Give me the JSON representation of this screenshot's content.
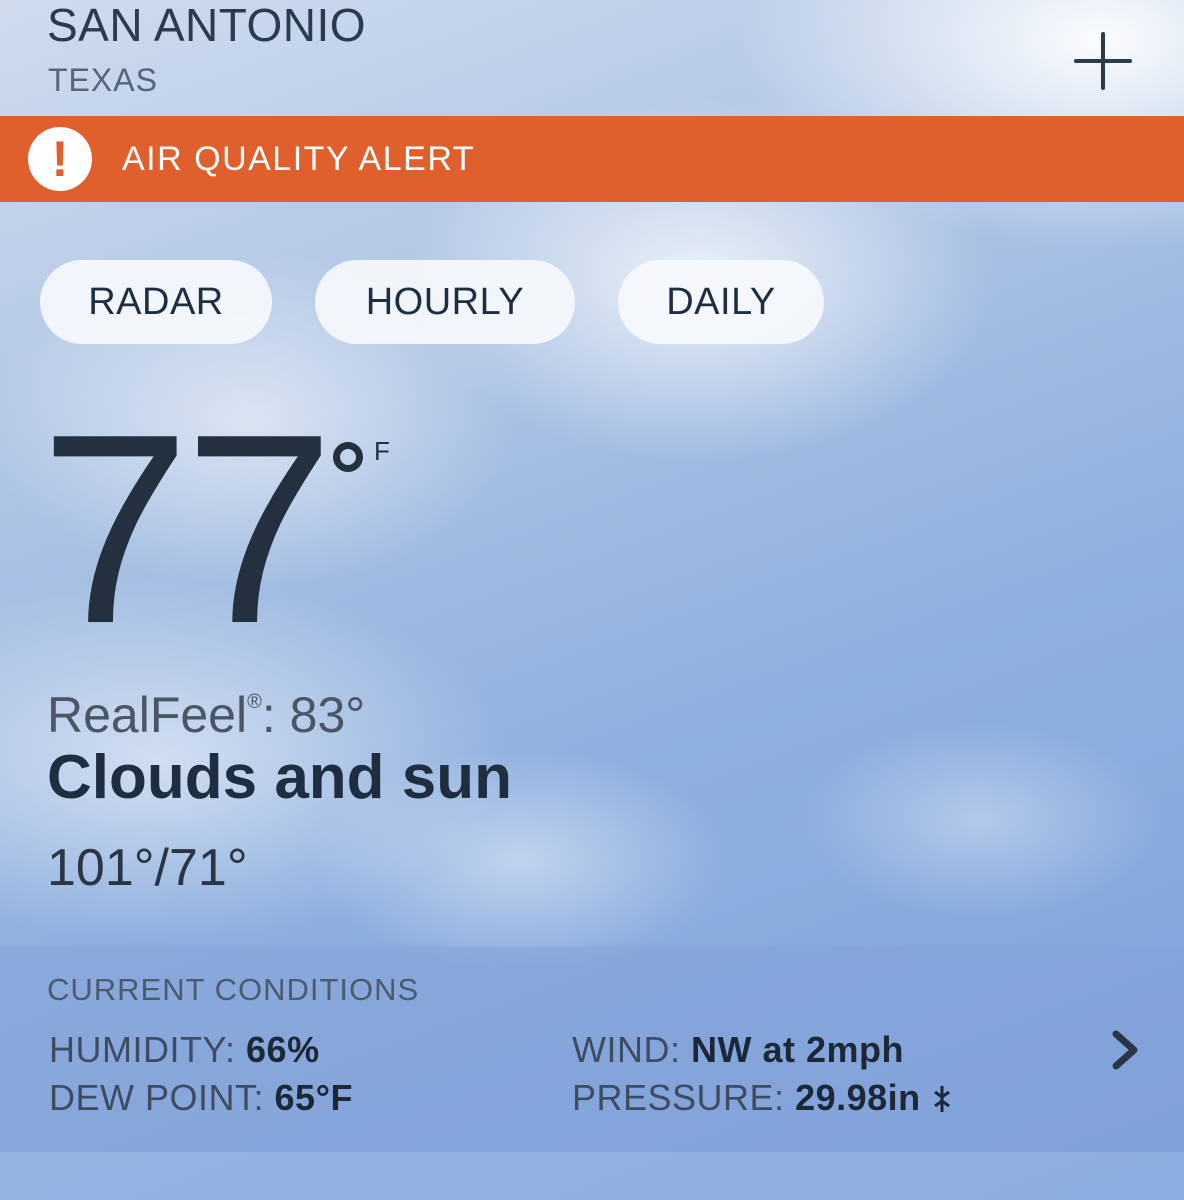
{
  "header": {
    "city": "SAN ANTONIO",
    "state": "TEXAS",
    "add_icon": "plus-icon"
  },
  "alert": {
    "icon": "exclamation-icon",
    "mark": "!",
    "text": "AIR QUALITY ALERT",
    "color": "#e0602d"
  },
  "tabs": [
    {
      "label": "RADAR"
    },
    {
      "label": "HOURLY"
    },
    {
      "label": "DAILY"
    }
  ],
  "current": {
    "temperature": "77",
    "unit": "F",
    "realfeel_label": "RealFeel",
    "realfeel_mark": "®",
    "realfeel_value": ": 83°",
    "phrase": "Clouds and sun",
    "hi_lo": "101°/71°"
  },
  "conditions": {
    "title": "CURRENT CONDITIONS",
    "humidity_label": "HUMIDITY:",
    "humidity_value": "66%",
    "dew_point_label": "DEW POINT:",
    "dew_point_value": "65°F",
    "wind_label": "WIND:",
    "wind_value": "NW at 2mph",
    "pressure_label": "PRESSURE:",
    "pressure_value": "29.98in",
    "pressure_trend_icon": "pressure-steady-icon",
    "more_icon": "chevron-right-icon"
  }
}
